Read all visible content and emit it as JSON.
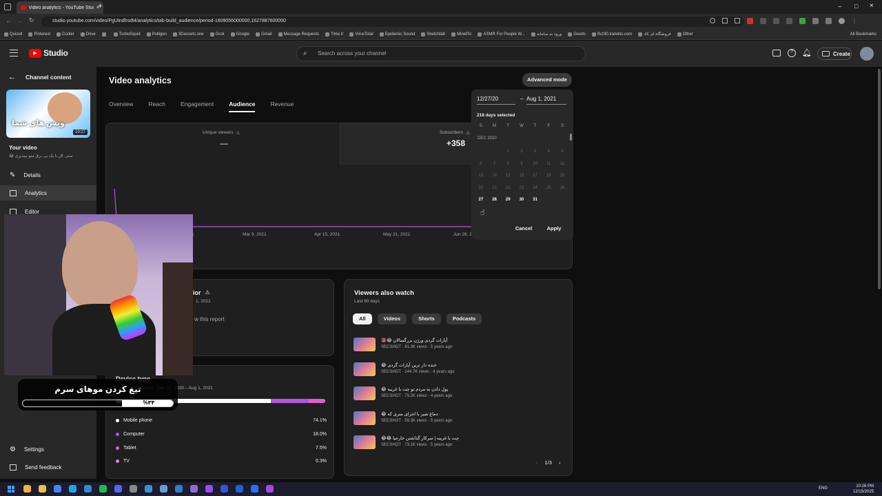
{
  "browser": {
    "tab_title": "Video analytics - YouTube Studio",
    "new_tab": "+",
    "url": "studio.youtube.com/video/PgUtndhsdt4/analytics/tab-build_audience/period-1609056000000,1627887600000",
    "bookmarks": [
      "Quizell",
      "Pinterest",
      "Cooler",
      "Drive",
      "",
      "TurboSquid",
      "Polligon",
      "3Dassets.one",
      "Grok",
      "Google",
      "Gmail",
      "Message Requests",
      "Time.Ir",
      "VirusTotal",
      "Epidemic Sound",
      "Sketchfab",
      "MinePic",
      "ASMR For People W...",
      "ورود به سامانه",
      "Goods",
      "lfs230.irandns.com",
      "فروشگاه ای کاد",
      "Other"
    ],
    "all_bookmarks": "All Bookmarks"
  },
  "studio": {
    "logo_text": "Studio",
    "search_placeholder": "Search across your channel",
    "create_label": "Create"
  },
  "sidebar": {
    "back_label": "Channel content",
    "thumb_duration": "10:27",
    "thumb_text": "ویس های شما",
    "your_video": "Your video",
    "video_title": "ستی کل با یک بی برق متو بپندیری 😂",
    "items": [
      {
        "label": "Details",
        "icon": "pencil-icon"
      },
      {
        "label": "Analytics",
        "icon": "analytics-icon"
      },
      {
        "label": "Editor",
        "icon": "editor-icon"
      }
    ],
    "settings": "Settings",
    "feedback": "Send feedback"
  },
  "main": {
    "page_title": "Video analytics",
    "advanced_mode": "Advanced mode",
    "tabs": [
      "Overview",
      "Reach",
      "Engagement",
      "Audience",
      "Revenue"
    ],
    "active_tab": "Audience",
    "unique_viewers_label": "Unique viewers",
    "unique_viewers_value": "—",
    "subscribers_label": "Subscribers",
    "subscribers_value": "+358",
    "chart_dates": [
      "Mar 9, 2021",
      "Apr 15, 2021",
      "May 21, 2021",
      "Jun 26, 2"
    ],
    "partial_date_left": "1",
    "partial_card_title": "ior",
    "partial_card_sub": "1, 2021",
    "partial_card_link": "w this report"
  },
  "calendar": {
    "start_date": "12/27/20",
    "dash": "–",
    "end_date": "Aug 1, 2021",
    "days_selected": "218 days selected",
    "weekdays": [
      "S",
      "M",
      "T",
      "W",
      "T",
      "F",
      "S"
    ],
    "month": "DEC 2020",
    "days": [
      "",
      "",
      "1",
      "2",
      "3",
      "4",
      "5",
      "6",
      "7",
      "8",
      "9",
      "10",
      "11",
      "12",
      "13",
      "14",
      "15",
      "16",
      "17",
      "18",
      "19",
      "20",
      "21",
      "22",
      "23",
      "24",
      "25",
      "26",
      "27",
      "28",
      "29",
      "30",
      "31"
    ],
    "cancel": "Cancel",
    "apply": "Apply"
  },
  "device": {
    "title": "Device type",
    "subtitle": "hours) · Dec 27, 2020 – Aug 1, 2021",
    "rows": [
      {
        "label": "Mobile phone",
        "value": "74.1%",
        "color": "#ffffff",
        "share": 0.741
      },
      {
        "label": "Computer",
        "value": "18.0%",
        "color": "#b455e0",
        "share": 0.18
      },
      {
        "label": "Tablet",
        "value": "7.5%",
        "color": "#e65ad6",
        "share": 0.075
      },
      {
        "label": "TV",
        "value": "0.3%",
        "color": "#f07ad0",
        "share": 0.003
      }
    ]
  },
  "viewers_also_watch": {
    "title": "Viewers also watch",
    "subtitle": "Last 90 days",
    "filters": [
      "All",
      "Videos",
      "Shorts",
      "Podcasts"
    ],
    "videos": [
      {
        "title": "آپارات گردی ورژن بزرگسالان 😂🔞",
        "meta": "SECSHOT · 81.3K views · 5 years ago"
      },
      {
        "title": "خنده دار ترین آپارات گردی 😂",
        "meta": "SECSHOT · 144.7K views · 4 years ago"
      },
      {
        "title": "پول دادن به مردم تو چت با غریبه 😂",
        "meta": "SECSHOT · 79.2K views · 4 years ago"
      },
      {
        "title": "دماغ شیر با اجرای متری که 😂",
        "meta": "SECSHOT · 59.3K views · 5 years ago"
      },
      {
        "title": "چت با غریبه | سرکار گذاشتن خارجیا 😂😂",
        "meta": "SECSHOT · 73.1K views · 5 years ago"
      }
    ],
    "pagination": "1/3"
  },
  "overlay": {
    "caption": "تیغ کردن موهای سرم",
    "progress_text": "%۳۴",
    "progress": 0.34
  },
  "taskbar": {
    "lang": "ENG",
    "time": "10:26 PM",
    "date": "12/15/2025"
  }
}
